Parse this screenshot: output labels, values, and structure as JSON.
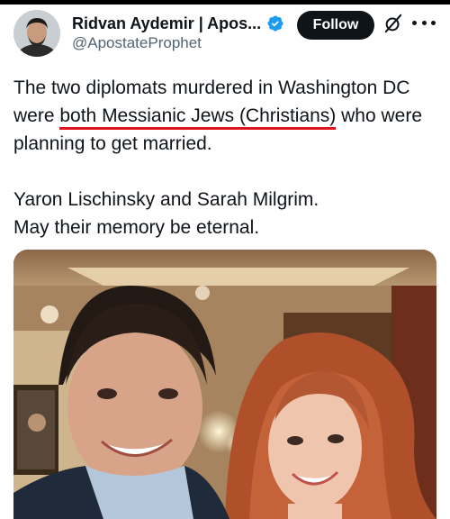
{
  "author": {
    "display_name": "Ridvan Aydemir | Apos...",
    "handle": "@ApostateProphet",
    "verified": true,
    "avatar": "profile-photo"
  },
  "actions": {
    "follow_label": "Follow",
    "grok_icon": "grok-icon",
    "more_icon": "more-icon"
  },
  "tweet": {
    "line1": "The two diplomats murdered in Washington DC",
    "line2_prefix": "were ",
    "line2_highlight": "both Messianic Jews (Christians)",
    "line2_suffix": " who were",
    "line3": "planning to get married.",
    "line4": "Yaron Lischinsky and Sarah Milgrim.",
    "line5": "May their memory be eternal."
  },
  "media": {
    "type": "photo"
  },
  "colors": {
    "text": "#0f1419",
    "secondary_text": "#536471",
    "verified_blue": "#1d9bf0",
    "underline_red": "#e0141e",
    "follow_button": "#0f1419"
  }
}
